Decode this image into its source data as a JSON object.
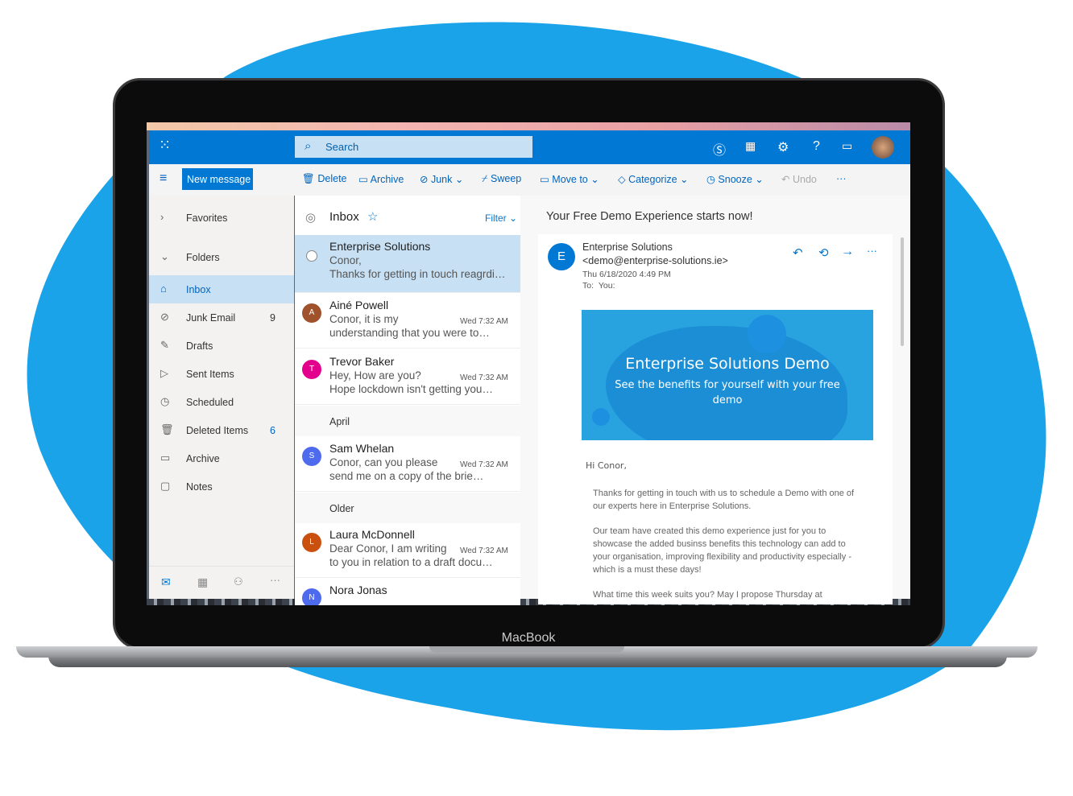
{
  "device": {
    "brand": "MacBook"
  },
  "header": {
    "search_placeholder": "Search",
    "icons": [
      "app-launcher-icon",
      "skype-icon",
      "calendar-check-icon",
      "gear-icon",
      "help-icon",
      "feedback-icon",
      "avatar"
    ]
  },
  "toolbar": {
    "new_message": "New message",
    "actions": [
      "Delete",
      "Archive",
      "Junk",
      "Sweep",
      "Move to",
      "Categorize",
      "Snooze",
      "Undo"
    ],
    "more": "···"
  },
  "sidebar": {
    "favorites": "Favorites",
    "folders": "Folders",
    "items": [
      {
        "label": "Inbox",
        "count": "",
        "icon": "inbox-icon"
      },
      {
        "label": "Junk Email",
        "count": "9",
        "icon": "block-icon"
      },
      {
        "label": "Drafts",
        "count": "",
        "icon": "pencil-icon"
      },
      {
        "label": "Sent Items",
        "count": "",
        "icon": "send-icon"
      },
      {
        "label": "Scheduled",
        "count": "",
        "icon": "clock-icon"
      },
      {
        "label": "Deleted Items",
        "count": "6",
        "icon": "trash-icon"
      },
      {
        "label": "Archive",
        "count": "",
        "icon": "archive-icon"
      },
      {
        "label": "Notes",
        "count": "",
        "icon": "note-icon"
      }
    ],
    "bottom_more": "···"
  },
  "list": {
    "title": "Inbox",
    "filter": "Filter",
    "groups": [
      "April",
      "Older"
    ],
    "messages": [
      {
        "sender": "Enterprise Solutions",
        "line1": "Conor,",
        "line2": "Thanks for getting in touch reagrdi…",
        "time": "",
        "initial": "",
        "color": ""
      },
      {
        "sender": "Ainé Powell",
        "line1": "Conor, it is my",
        "line2": "understanding that you were to…",
        "time": "Wed 7:32 AM",
        "initial": "A",
        "color": "#a0522d"
      },
      {
        "sender": "Trevor Baker",
        "line1": "Hey, How are you?",
        "line2": "Hope lockdown isn't getting you…",
        "time": "Wed 7:32 AM",
        "initial": "T",
        "color": "#e3008c"
      },
      {
        "sender": "Sam Whelan",
        "line1": "Conor, can you please",
        "line2": "send me on a copy of the brie…",
        "time": "Wed 7:32 AM",
        "initial": "S",
        "color": "#4f6bed"
      },
      {
        "sender": "Laura McDonnell",
        "line1": "Dear Conor, I am writing",
        "line2": "to you in relation to a draft docu…",
        "time": "Wed 7:32 AM",
        "initial": "L",
        "color": "#ca5010"
      },
      {
        "sender": "Nora Jonas",
        "line1": "",
        "line2": "",
        "time": "",
        "initial": "N",
        "color": "#4f6bed"
      }
    ]
  },
  "reading": {
    "subject": "Your Free Demo Experience starts now!",
    "sender": "Enterprise Solutions",
    "email": "<demo@enterprise-solutions.ie>",
    "date": "Thu 6/18/2020 4:49 PM",
    "to_label": "To:",
    "to": "You:",
    "initial": "E",
    "banner_title": "Enterprise Solutions Demo",
    "banner_sub": "See the benefits for yourself with your free demo",
    "greeting": "Hi Conor,",
    "p1": "Thanks for getting in touch with us to schedule a Demo with one of our experts here in Enterprise Solutions.",
    "p2": "Our team have created this demo experience just for you to showcase the added businss benefits this technology can add to your organisation, improving flexibility and productivity especially - which is a must these days!",
    "p3": "What time this week suits you? May I propose Thursday at"
  },
  "colors": {
    "brand": "#0078d4",
    "background_blob": "#1aa3e8",
    "selected": "#c7e0f4"
  }
}
